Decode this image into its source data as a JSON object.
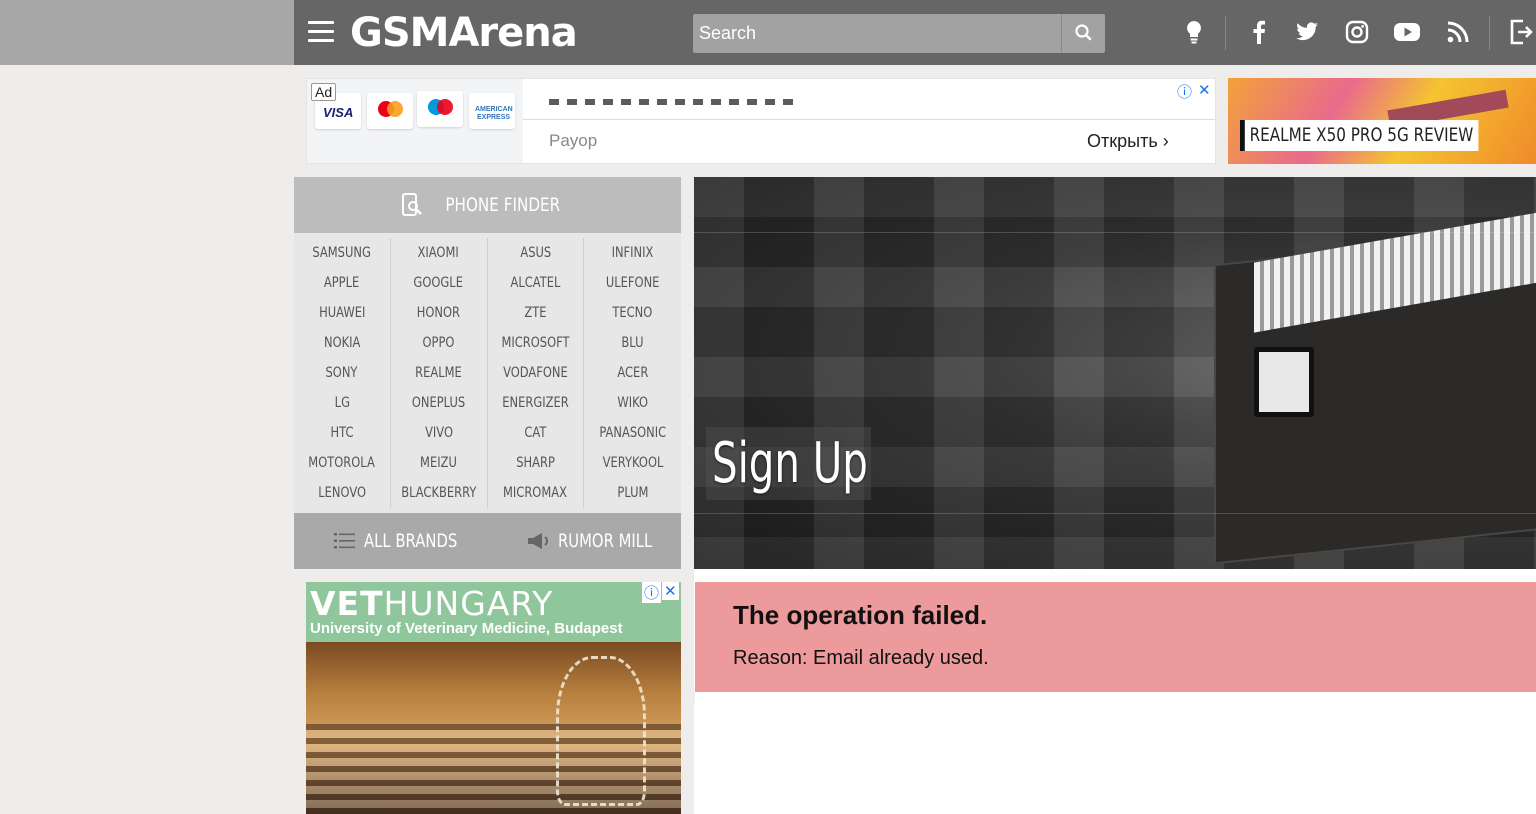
{
  "header": {
    "logo": "GSMArena",
    "search_placeholder": "Search"
  },
  "ad_top": {
    "badge": "Ad",
    "advertiser": "Payop",
    "open_label": "Открыть ›",
    "info_icon": "ⓘ",
    "close_icon": "✕"
  },
  "review_banner": {
    "label": "REALME X50 PRO 5G REVIEW"
  },
  "phone_finder": {
    "title": "PHONE FINDER",
    "brands": [
      "SAMSUNG",
      "XIAOMI",
      "ASUS",
      "INFINIX",
      "APPLE",
      "GOOGLE",
      "ALCATEL",
      "ULEFONE",
      "HUAWEI",
      "HONOR",
      "ZTE",
      "TECNO",
      "NOKIA",
      "OPPO",
      "MICROSOFT",
      "BLU",
      "SONY",
      "REALME",
      "VODAFONE",
      "ACER",
      "LG",
      "ONEPLUS",
      "ENERGIZER",
      "WIKO",
      "HTC",
      "VIVO",
      "CAT",
      "PANASONIC",
      "MOTOROLA",
      "MEIZU",
      "SHARP",
      "VERYKOOL",
      "LENOVO",
      "BLACKBERRY",
      "MICROMAX",
      "PLUM"
    ],
    "all_brands": "ALL BRANDS",
    "rumor_mill": "RUMOR MILL"
  },
  "ad_side": {
    "title_bold": "VET",
    "title_rest": "HUNGARY",
    "subtitle": "University of Veterinary Medicine, Budapest",
    "info_icon": "ⓘ",
    "close_icon": "✕"
  },
  "hero": {
    "title": "Sign Up"
  },
  "error": {
    "title": "The operation failed.",
    "reason": "Reason: Email already used."
  },
  "colors": {
    "header_bg": "#666666",
    "error_bg": "#ec9a9c",
    "finder_head": "#bcbcbc",
    "finder_foot": "#a9a9a9"
  }
}
